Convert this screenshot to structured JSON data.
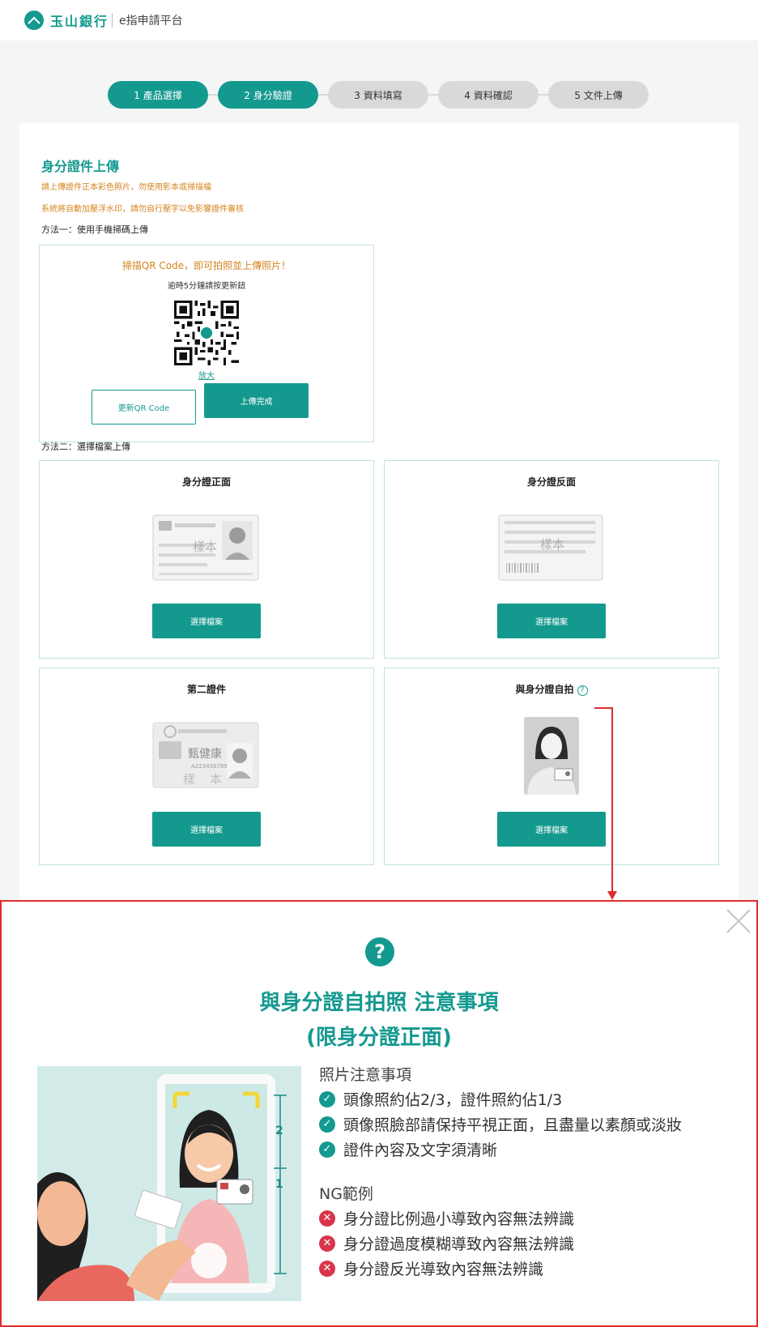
{
  "header": {
    "bank_name": "玉山銀行",
    "platform_name": "e指申請平台"
  },
  "steps": [
    {
      "label": "1 產品選擇",
      "state": "done"
    },
    {
      "label": "2 身分驗證",
      "state": "current"
    },
    {
      "label": "3 資料填寫",
      "state": "todo"
    },
    {
      "label": "4 資料確認",
      "state": "todo"
    },
    {
      "label": "5 文件上傳",
      "state": "todo"
    }
  ],
  "upload_section": {
    "title": "身分證件上傳",
    "note_1": "請上傳證件正本彩色照片，勿使用影本或掃描檔",
    "note_2": "系統將自動加壓浮水印，請勿自行壓字以免影響證件審核",
    "method_1": "方法一：使用手機掃碼上傳",
    "qr": {
      "headline": "掃描QR Code，即可拍照並上傳照片！",
      "subline": "逾時5分鐘請按更新鈕",
      "zoom_link": "放大",
      "refresh_button": "更新QR Code",
      "done_button": "上傳完成"
    },
    "method_2": "方法二：選擇檔案上傳",
    "cards": [
      {
        "title": "身分證正面",
        "button": "選擇檔案"
      },
      {
        "title": "身分證反面",
        "button": "選擇檔案"
      },
      {
        "title": "第二證件",
        "button": "選擇檔案"
      },
      {
        "title": "與身分證自拍",
        "button": "選擇檔案"
      }
    ],
    "sample_watermark": "樣本",
    "second_id_sample": {
      "name": "甄健康",
      "id": "A223456789"
    }
  },
  "modal": {
    "title_line1": "與身分證自拍照 注意事項",
    "title_line2": "(限身分證正面)",
    "tips_heading": "照片注意事項",
    "tips": [
      "頭像照約佔2/3，證件照約佔1/3",
      "頭像照臉部請保持平視正面，且盡量以素顏或淡妝",
      "證件內容及文字須清晰"
    ],
    "ng_heading": "NG範例",
    "ng_items": [
      "身分證比例過小導致內容無法辨識",
      "身分證過度模糊導致內容無法辨識",
      "身分證反光導致內容無法辨識"
    ],
    "ratio_labels": {
      "face": "2",
      "card": "1"
    }
  },
  "colors": {
    "brand": "#14998f",
    "warning_text": "#d4841f",
    "annotation_red": "#e12b2b"
  }
}
